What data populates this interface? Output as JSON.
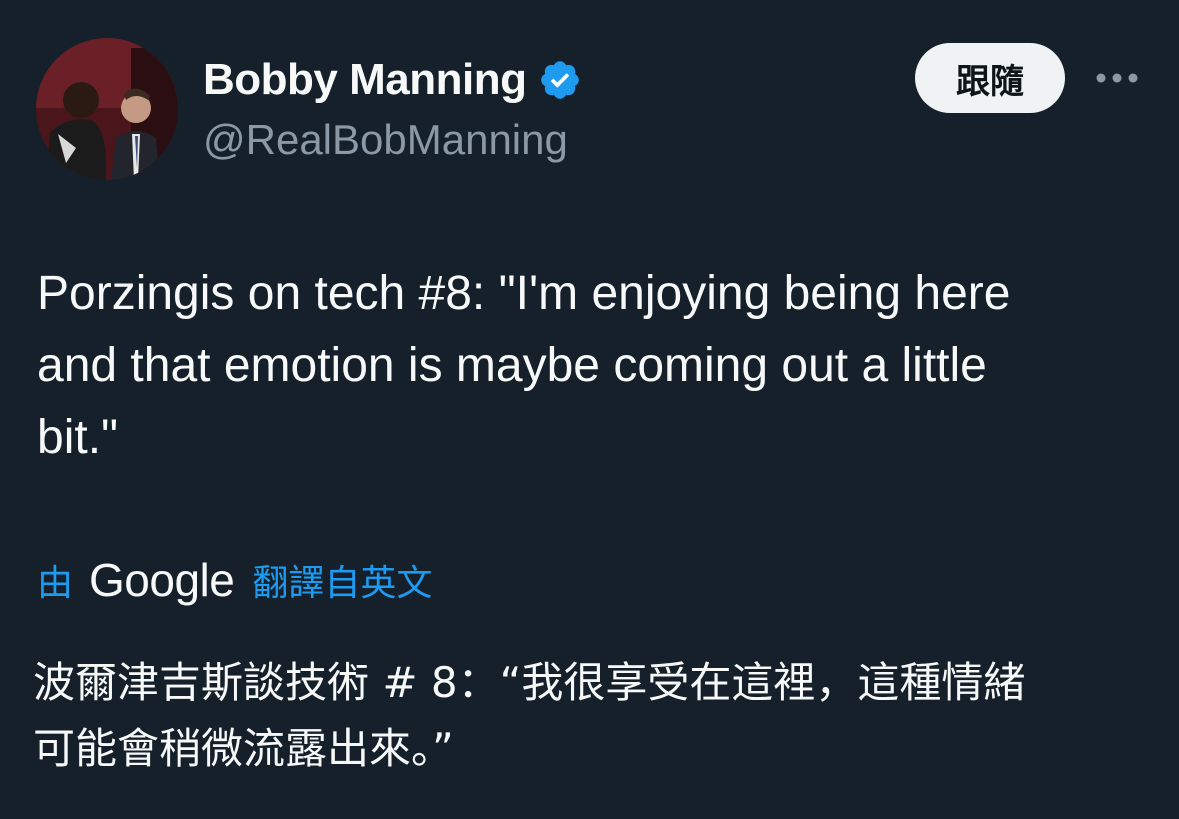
{
  "author": {
    "display_name": "Bobby Manning",
    "handle": "@RealBobManning",
    "verified": true,
    "avatar_icon": "profile-photo"
  },
  "actions": {
    "follow_label": "跟隨",
    "more_icon": "more-horizontal-icon"
  },
  "tweet": {
    "text": "Porzingis on tech #8: \"I'm enjoying being here\nand that emotion is maybe coming out a little\nbit.\""
  },
  "translation": {
    "by_label": "由",
    "provider": "Google",
    "link_label": "翻譯自英文",
    "text": "波爾津吉斯談技術 # 8：“我很享受在這裡，這種情緒\n可能會稍微流露出來。”"
  },
  "colors": {
    "background": "#15202b",
    "primary_text": "#f7f9f9",
    "secondary_text": "#8b98a5",
    "accent": "#1d9bf0",
    "follow_button_bg": "#eff3f4"
  }
}
